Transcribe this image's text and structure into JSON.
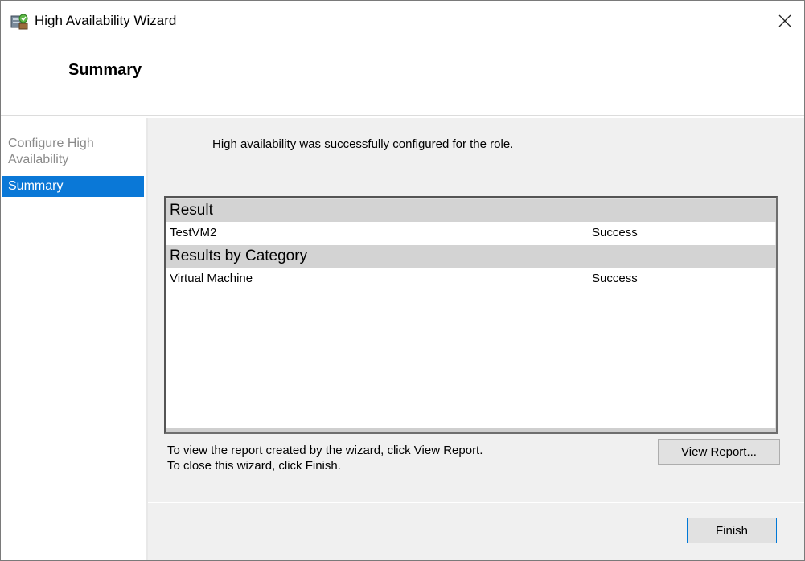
{
  "window": {
    "title": "High Availability Wizard",
    "icon": "wizard-app-icon"
  },
  "header": {
    "page_title": "Summary"
  },
  "nav": {
    "items": [
      {
        "label": "Configure High Availability",
        "state": "disabled"
      },
      {
        "label": "Summary",
        "state": "active"
      }
    ]
  },
  "content": {
    "message": "High availability was successfully configured for the role.",
    "results": {
      "sections": [
        {
          "header": "Result",
          "rows": [
            {
              "name": "TestVM2",
              "status": "Success"
            }
          ]
        },
        {
          "header": "Results by Category",
          "rows": [
            {
              "name": "Virtual Machine",
              "status": "Success"
            }
          ]
        }
      ]
    },
    "hint_line1": "To view the report created by the wizard, click View Report.",
    "hint_line2": "To close this wizard, click Finish.",
    "view_report_label": "View Report..."
  },
  "footer": {
    "finish_label": "Finish"
  },
  "colors": {
    "accent": "#0a78d7",
    "section_header_bg": "#d3d3d3",
    "panel_bg": "#f0f0f0"
  }
}
